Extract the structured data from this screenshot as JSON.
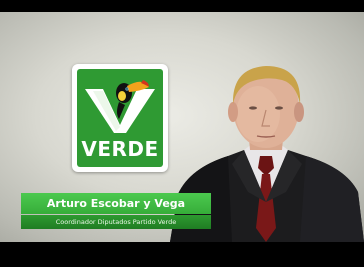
{
  "logo": {
    "text": "VERDE",
    "icon": "toucan-icon",
    "colors": {
      "green": "#2f9a33",
      "white": "#ffffff"
    }
  },
  "lower_third": {
    "name": "Arturo Escobar y Vega",
    "title": "Coordinador Diputados Partido Verde",
    "colors": {
      "name_bar": "#3dbb40",
      "title_bar": "#27892a"
    }
  }
}
